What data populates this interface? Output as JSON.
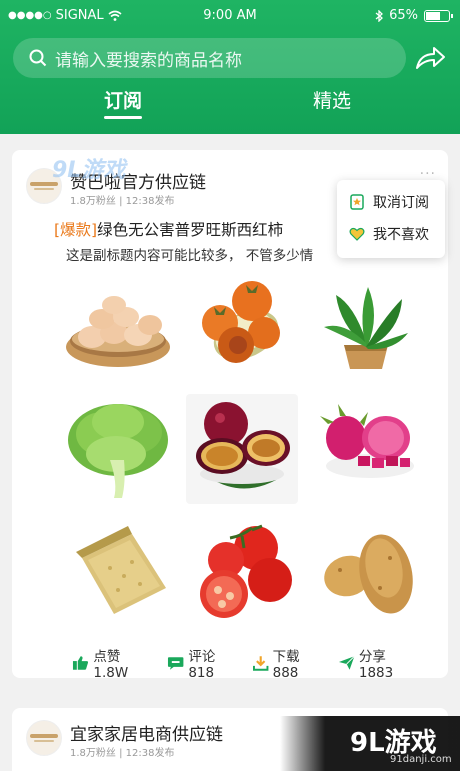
{
  "status_bar": {
    "carrier": "SIGNAL",
    "time": "9:00 AM",
    "battery": "65%",
    "battery_level": 0.65
  },
  "search": {
    "placeholder": "请输入要搜索的商品名称"
  },
  "tabs": [
    {
      "label": "订阅",
      "active": true
    },
    {
      "label": "精选",
      "active": false
    }
  ],
  "post": {
    "shop_name": "赞巴啦官方供应链",
    "meta": "1.8万粉丝 | 12:38发布",
    "more": "···",
    "title_tag": "[爆款]",
    "title_rest": "绿色无公害普罗旺斯西红柿",
    "subtitle": "这是副标题内容可能比较多，  不管多少情",
    "images": [
      "eggs",
      "persimmons",
      "spinach",
      "lettuce",
      "passion-fruit",
      "dragon-fruit",
      "millet",
      "tomatoes",
      "potatoes"
    ],
    "actions": [
      {
        "icon": "thumbs-up-icon",
        "label": "点赞1.8W"
      },
      {
        "icon": "comment-icon",
        "label": "评论818"
      },
      {
        "icon": "download-icon",
        "label": "下载888"
      },
      {
        "icon": "share-icon",
        "label": "分享1883"
      }
    ]
  },
  "popup_menu": [
    {
      "icon": "unsubscribe-icon",
      "label": "取消订阅"
    },
    {
      "icon": "dislike-icon",
      "label": "我不喜欢"
    }
  ],
  "post2": {
    "shop_name": "宜家家居电商供应链",
    "meta": "1.8万粉丝 | 12:38发布"
  },
  "watermark": {
    "top": "9L游戏",
    "logo": "9L游戏",
    "url": "91danji.com"
  },
  "colors": {
    "brand": "#17a85c",
    "tag": "#ea7a1c"
  }
}
